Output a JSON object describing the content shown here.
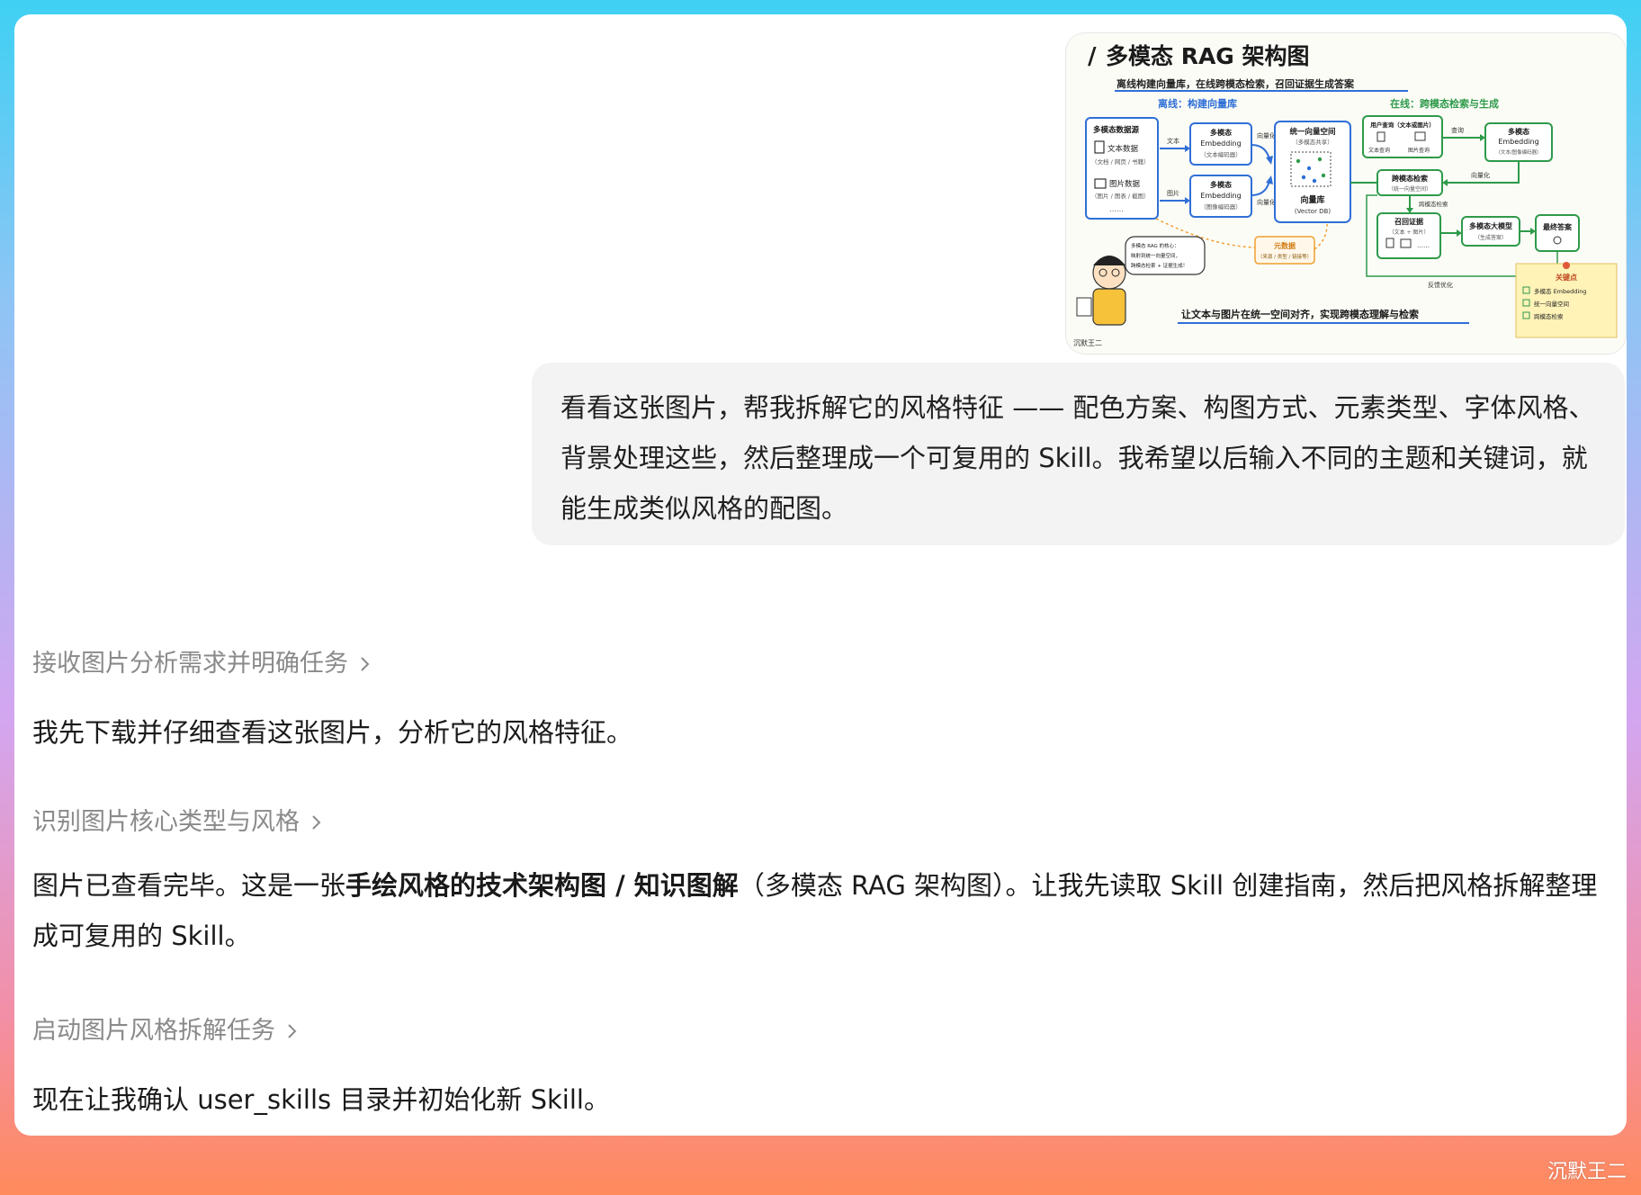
{
  "thumbnail": {
    "title": "多模态 RAG 架构图",
    "subtitle": "离线构建向量库，在线跨模态检索，召回证据生成答案",
    "offline_label": "离线：构建向量库",
    "online_label": "在线：跨模态检索与生成",
    "source_box": {
      "title": "多模态数据源",
      "text_item": "文本数据",
      "text_sub": "（文档 / 网页 / 书籍）",
      "image_item": "图片数据",
      "image_sub": "（图片 / 图表 / 截图）",
      "more": "……"
    },
    "edge_text": "文本",
    "edge_image": "图片",
    "edge_vectorize_1": "向量化",
    "edge_vectorize_2": "向量化",
    "emb_text": {
      "l1": "多模态",
      "l2": "Embedding",
      "l3": "（文本编码器）"
    },
    "emb_image": {
      "l1": "多模态",
      "l2": "Embedding",
      "l3": "（图像编码器）"
    },
    "vector_space": {
      "l1": "统一向量空间",
      "l2": "（多模态共享）",
      "db": "向量库",
      "db_en": "(Vector DB)"
    },
    "metadata": {
      "l1": "元数据",
      "l2": "（来源 / 类型 / 链接等）"
    },
    "user_query": {
      "l1": "用户查询（文本或图片）",
      "text_q": "文本查询",
      "img_q": "图片查询"
    },
    "edge_query": "查询",
    "emb_online": {
      "l1": "多模态",
      "l2": "Embedding",
      "l3": "（文本/图像编码器）"
    },
    "edge_vectorize_3": "向量化",
    "cross_search": {
      "l1": "跨模态检索",
      "l2": "（统一向量空间）"
    },
    "edge_cross": "跨模态检索",
    "recall": {
      "l1": "召回证据",
      "l2": "（文本 + 图片）",
      "more": "……"
    },
    "llm": {
      "l1": "多模态大模型",
      "l2": "（生成答案）"
    },
    "final": "最终答案",
    "feedback": "反馈优化",
    "speech": {
      "l1": "多模态 RAG 的核心：",
      "l2": "映射到统一向量空间，",
      "l3": "跨模态检索 + 证据生成！"
    },
    "keypoints": {
      "title": "关键点",
      "items": [
        "多模态 Embedding",
        "统一向量空间",
        "跨模态检索"
      ]
    },
    "bottom_caption": "让文本与图片在统一空间对齐，实现跨模态理解与检索",
    "signature": "沉默王二"
  },
  "user_message": "看看这张图片，帮我拆解它的风格特征 —— 配色方案、构图方式、元素类型、字体风格、背景处理这些，然后整理成一个可复用的 Skill。我希望以后输入不同的主题和关键词，就能生成类似风格的配图。",
  "step1": {
    "label": "接收图片分析需求并明确任务"
  },
  "reply1": "我先下载并仔细查看这张图片，分析它的风格特征。",
  "step2": {
    "label": "识别图片核心类型与风格"
  },
  "reply2": {
    "pre": "图片已查看完毕。这是一张",
    "bold": "手绘风格的技术架构图 / 知识图解",
    "post": "（多模态 RAG 架构图）。让我先读取 Skill 创建指南，然后把风格拆解整理成可复用的 Skill。"
  },
  "step3": {
    "label": "启动图片风格拆解任务"
  },
  "reply3": "现在让我确认 user_skills 目录并初始化新 Skill。",
  "watermark": "沉默王二",
  "colors": {
    "text_primary": "#1a1a1a",
    "text_muted": "#8a8a8a",
    "bubble_bg": "#f3f3f3",
    "diagram_blue": "#2f6fd6",
    "diagram_green": "#2e9a4a",
    "diagram_orange": "#f0a030",
    "diagram_yellow": "#fff3b8"
  }
}
